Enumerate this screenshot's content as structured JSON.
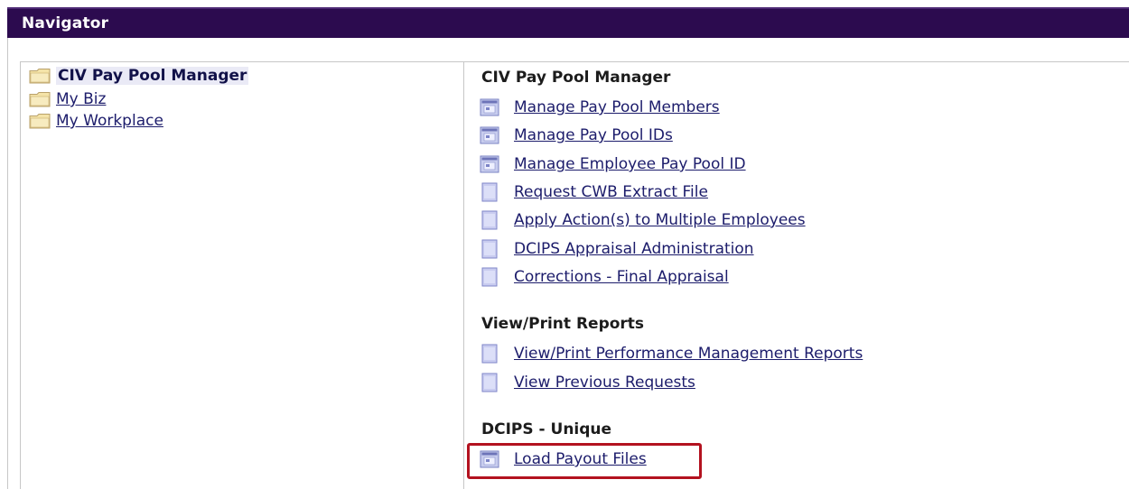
{
  "header": {
    "title": "Navigator"
  },
  "tree": {
    "items": [
      {
        "label": "CIV Pay Pool Manager",
        "icon": "folder-icon",
        "selected": true
      },
      {
        "label": "My Biz",
        "icon": "folder-icon",
        "selected": false
      },
      {
        "label": "My Workplace",
        "icon": "folder-icon",
        "selected": false
      }
    ]
  },
  "sections": [
    {
      "title": "CIV Pay Pool Manager",
      "links": [
        {
          "label": "Manage Pay Pool Members",
          "icon": "component-page-icon"
        },
        {
          "label": "Manage Pay Pool IDs",
          "icon": "component-page-icon"
        },
        {
          "label": "Manage Employee Pay Pool ID",
          "icon": "component-page-icon"
        },
        {
          "label": "Request CWB Extract File",
          "icon": "document-page-icon"
        },
        {
          "label": "Apply Action(s) to Multiple Employees",
          "icon": "document-page-icon"
        },
        {
          "label": "DCIPS Appraisal Administration",
          "icon": "document-page-icon"
        },
        {
          "label": "Corrections - Final Appraisal",
          "icon": "document-page-icon"
        }
      ]
    },
    {
      "title": "View/Print Reports",
      "links": [
        {
          "label": "View/Print Performance Management Reports",
          "icon": "document-page-icon"
        },
        {
          "label": "View Previous Requests",
          "icon": "document-page-icon"
        }
      ]
    },
    {
      "title": "DCIPS - Unique",
      "links": [
        {
          "label": "Load Payout Files",
          "icon": "component-page-icon"
        }
      ]
    }
  ],
  "colors": {
    "header_bg": "#2c0b4f",
    "link": "#1c1c6b",
    "highlight": "#b3121f"
  }
}
